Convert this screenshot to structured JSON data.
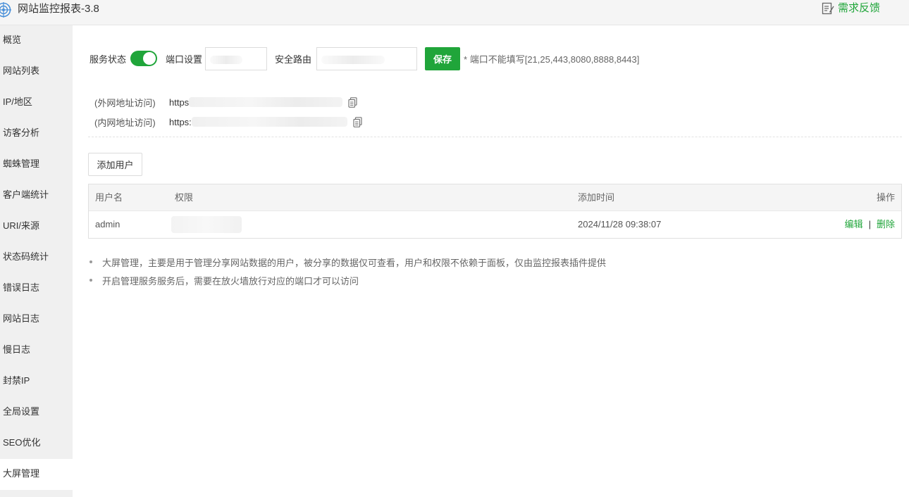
{
  "window": {
    "title": "网站监控报表-3.8",
    "icon": "target-globe-icon",
    "feedback_label": "需求反馈",
    "feedback_icon": "edit-note-icon"
  },
  "sidebar": {
    "items": [
      {
        "label": "概览"
      },
      {
        "label": "网站列表"
      },
      {
        "label": "IP/地区"
      },
      {
        "label": "访客分析"
      },
      {
        "label": "蜘蛛管理"
      },
      {
        "label": "客户端统计"
      },
      {
        "label": "URI/来源"
      },
      {
        "label": "状态码统计"
      },
      {
        "label": "错误日志"
      },
      {
        "label": "网站日志"
      },
      {
        "label": "慢日志"
      },
      {
        "label": "封禁IP"
      },
      {
        "label": "全局设置"
      },
      {
        "label": "SEO优化"
      },
      {
        "label": "大屏管理",
        "active": true
      }
    ]
  },
  "settings": {
    "service_status_label": "服务状态",
    "service_enabled": true,
    "port_label": "端口设置",
    "port_value": "",
    "route_label": "安全路由",
    "route_value": "",
    "save_label": "保存",
    "port_note": "* 端口不能填写[21,25,443,8080,8888,8443]"
  },
  "access": {
    "external_label": "(外网地址访问)",
    "external_url": "https",
    "internal_label": "(内网地址访问)",
    "internal_url": "https:"
  },
  "add_user_label": "添加用户",
  "table": {
    "columns": {
      "username": "用户名",
      "permission": "权限",
      "added_time": "添加时间",
      "actions": "操作"
    },
    "rows": [
      {
        "username": "admin",
        "permission": "",
        "added_time": "2024/11/28 09:38:07",
        "edit_label": "编辑",
        "separator": "|",
        "delete_label": "删除"
      }
    ]
  },
  "notes": [
    "大屏管理，主要是用于管理分享网站数据的用户，被分享的数据仅可查看，用户和权限不依赖于面板，仅由监控报表插件提供",
    "开启管理服务服务后，需要在放火墙放行对应的端口才可以访问"
  ],
  "colors": {
    "accent": "#20a53a",
    "sidebar_bg": "#f0f0f0",
    "titlebar_bg": "#f5f5f5"
  }
}
